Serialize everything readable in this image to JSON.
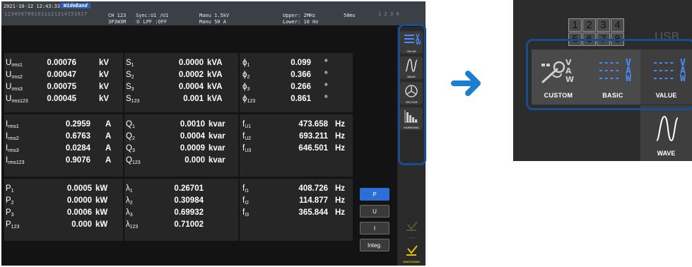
{
  "topbar": {
    "datetime": "2021-10-12 12:43:33",
    "wideband": "WideBand",
    "ch_grid": "1234567891011121314151617",
    "channel": "CH 123",
    "wiring": "3P3W3M",
    "sync": "Sync:U1  /U1",
    "lpf": "① LPF :OFF",
    "manu_voltage": "Manu  1.5kV",
    "manu_current": "Manu  50 A",
    "upper": "Upper:  2MHz",
    "lower": "Lower: 10 Hz",
    "rate": "50ms",
    "indicator": "1 2 3 4"
  },
  "panel_voltage": {
    "rows": [
      {
        "label": "U",
        "sub": "rms1",
        "value": "0.00076",
        "unit": "kV"
      },
      {
        "label": "U",
        "sub": "rms2",
        "value": "0.00047",
        "unit": "kV"
      },
      {
        "label": "U",
        "sub": "rms3",
        "value": "0.00075",
        "unit": "kV"
      },
      {
        "label": "U",
        "sub": "rms123",
        "value": "0.00045",
        "unit": "kV"
      }
    ]
  },
  "panel_apparent": {
    "rows": [
      {
        "label": "S",
        "sub": "1",
        "value": "0.0000",
        "unit": "kVA"
      },
      {
        "label": "S",
        "sub": "2",
        "value": "0.0002",
        "unit": "kVA"
      },
      {
        "label": "S",
        "sub": "3",
        "value": "0.0004",
        "unit": "kVA"
      },
      {
        "label": "S",
        "sub": "123",
        "value": "0.001",
        "unit": "kVA"
      }
    ]
  },
  "panel_phase": {
    "rows": [
      {
        "label": "ϕ",
        "sub": "1",
        "value": "0.099",
        "unit": "°"
      },
      {
        "label": "ϕ",
        "sub": "2",
        "value": "0.366",
        "unit": "°"
      },
      {
        "label": "ϕ",
        "sub": "3",
        "value": "0.266",
        "unit": "°"
      },
      {
        "label": "ϕ",
        "sub": "123",
        "value": "0.861",
        "unit": "°"
      }
    ]
  },
  "panel_current": {
    "rows": [
      {
        "label": "I",
        "sub": "rms1",
        "value": "0.2959",
        "unit": "A"
      },
      {
        "label": "I",
        "sub": "rms2",
        "value": "0.6763",
        "unit": "A"
      },
      {
        "label": "I",
        "sub": "rms3",
        "value": "0.0284",
        "unit": "A"
      },
      {
        "label": "I",
        "sub": "rms123",
        "value": "0.9076",
        "unit": "A"
      }
    ]
  },
  "panel_reactive": {
    "rows": [
      {
        "label": "Q",
        "sub": "1",
        "value": "0.0010",
        "unit": "kvar"
      },
      {
        "label": "Q",
        "sub": "2",
        "value": "0.0004",
        "unit": "kvar"
      },
      {
        "label": "Q",
        "sub": "3",
        "value": "0.0009",
        "unit": "kvar"
      },
      {
        "label": "Q",
        "sub": "123",
        "value": "0.000",
        "unit": "kvar"
      }
    ]
  },
  "panel_freq_u": {
    "rows": [
      {
        "label": "f",
        "sub": "U1",
        "value": "473.658",
        "unit": "Hz"
      },
      {
        "label": "f",
        "sub": "U2",
        "value": "693.211",
        "unit": "Hz"
      },
      {
        "label": "f",
        "sub": "U3",
        "value": "646.501",
        "unit": "Hz"
      }
    ]
  },
  "panel_power": {
    "rows": [
      {
        "label": "P",
        "sub": "1",
        "value": "0.0005",
        "unit": "kW"
      },
      {
        "label": "P",
        "sub": "2",
        "value": "0.0000",
        "unit": "kW"
      },
      {
        "label": "P",
        "sub": "3",
        "value": "0.0006",
        "unit": "kW"
      },
      {
        "label": "P",
        "sub": "123",
        "value": "0.000",
        "unit": "kW"
      }
    ]
  },
  "panel_pf": {
    "rows": [
      {
        "label": "λ",
        "sub": "1",
        "value": "0.26701"
      },
      {
        "label": "λ",
        "sub": "2",
        "value": "0.30984"
      },
      {
        "label": "λ",
        "sub": "3",
        "value": "0.69932"
      },
      {
        "label": "λ",
        "sub": "123",
        "value": "0.71002"
      }
    ]
  },
  "panel_freq_i": {
    "rows": [
      {
        "label": "f",
        "sub": "I1",
        "value": "408.726",
        "unit": "Hz"
      },
      {
        "label": "f",
        "sub": "I2",
        "value": "114.877",
        "unit": "Hz"
      },
      {
        "label": "f",
        "sub": "I3",
        "value": "365.844",
        "unit": "Hz"
      }
    ]
  },
  "mode_buttons": {
    "p": "P",
    "u": "U",
    "i": "I",
    "integ": "Integ."
  },
  "side_buttons": {
    "value": "VALUE",
    "wave": "WAVE",
    "vector": "VECTOR",
    "harmonic": "HARMONIC",
    "save": "SAVE",
    "shutdown": "SHUTDOWN"
  },
  "zoom": {
    "cells": [
      "1",
      "2",
      "3",
      "4",
      "5",
      "6",
      "7",
      "8"
    ],
    "usb": "USB",
    "custom": "CUSTOM",
    "basic": "BASIC",
    "value": "VALUE",
    "wave": "WAVE",
    "v": "V",
    "a": "A",
    "w": "W",
    "dashes": "----"
  },
  "colors": {
    "accent_blue": "#2b6fd6",
    "highlight": "#1a4d8f",
    "arrow": "#1b7fd0",
    "icon_yellow": "#e5c400"
  }
}
